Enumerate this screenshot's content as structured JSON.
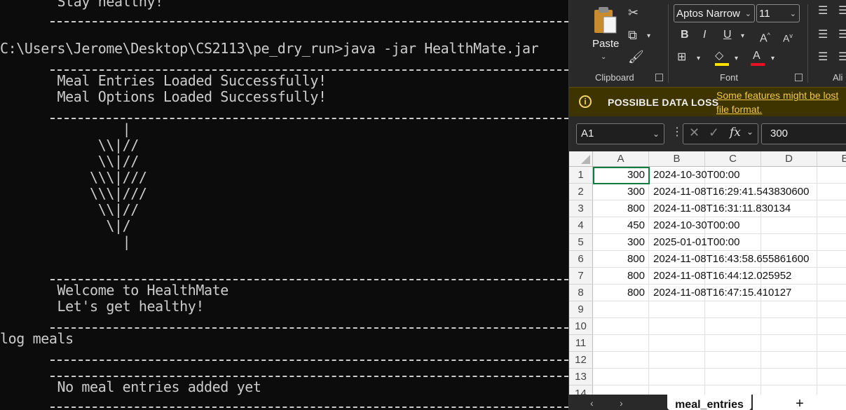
{
  "terminal": {
    "lines": {
      "stay_healthy": "       Stay healthy!",
      "prompt": "C:\\Users\\Jerome\\Desktop\\CS2113\\pe_dry_run>java -jar HealthMate.jar",
      "loaded1": "       Meal Entries Loaded Successfully!",
      "loaded2": "       Meal Options Loaded Successfully!",
      "art1": "               |",
      "art2": "            \\\\|//",
      "art3": "            \\\\|//",
      "art4": "           \\\\\\|///",
      "art5": "           \\\\\\|///",
      "art6": "            \\\\|//",
      "art7": "             \\|/",
      "art8": "               |",
      "welcome": "       Welcome to HealthMate",
      "lets": "       Let's get healthy!",
      "cmd": "log meals",
      "nomeal": "       No meal entries added yet"
    }
  },
  "excel": {
    "font_name": "Aptos Narrow",
    "font_size": "11",
    "paste_label": "Paste",
    "clipboard_label": "Clipboard",
    "font_group_label": "Font",
    "align_group_label": "Ali",
    "message": {
      "title": "POSSIBLE DATA LOSS",
      "link_line1": "Some features might be lost",
      "link_line2": "file format."
    },
    "name_box": "A1",
    "formula_value": "300",
    "columns": [
      "A",
      "B",
      "C",
      "D",
      "E"
    ],
    "rows": [
      "1",
      "2",
      "3",
      "4",
      "5",
      "6",
      "7",
      "8",
      "9",
      "10",
      "11",
      "12",
      "13",
      "14"
    ],
    "cells": [
      {
        "a": "300",
        "b": "2024-10-30T00:00"
      },
      {
        "a": "300",
        "b": "2024-11-08T16:29:41.543830600"
      },
      {
        "a": "800",
        "b": "2024-11-08T16:31:11.830134"
      },
      {
        "a": "450",
        "b": "2024-10-30T00:00"
      },
      {
        "a": "300",
        "b": "2025-01-01T00:00"
      },
      {
        "a": "800",
        "b": "2024-11-08T16:43:58.655861600"
      },
      {
        "a": "800",
        "b": "2024-11-08T16:44:12.025952"
      },
      {
        "a": "800",
        "b": "2024-11-08T16:47:15.410127"
      }
    ],
    "sheet_tab": "meal_entries",
    "add_sheet": "+",
    "accent_color": "#107c41",
    "highlight_color": "#ffe100",
    "font_color": "#e81123"
  }
}
